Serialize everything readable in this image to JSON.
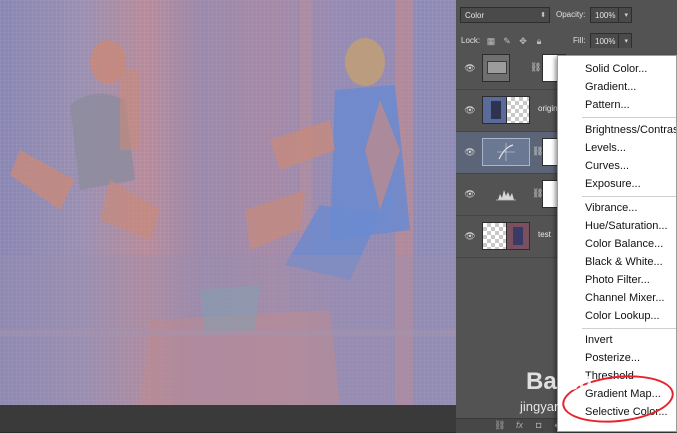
{
  "options_bar": {
    "blend_mode": "Color",
    "opacity_label": "Opacity:",
    "opacity_value": "100%",
    "lock_label": "Lock:",
    "fill_label": "Fill:",
    "fill_value": "100%"
  },
  "layers": [
    {
      "name": "",
      "kind": "adjustment-fill",
      "selected": false
    },
    {
      "name": "origin",
      "kind": "image-masked",
      "selected": false
    },
    {
      "name": "",
      "kind": "adjustment-curves",
      "selected": true
    },
    {
      "name": "",
      "kind": "adjustment-levels",
      "selected": false
    },
    {
      "name": "test",
      "kind": "image",
      "selected": false
    }
  ],
  "menu": {
    "group1": [
      "Solid Color...",
      "Gradient...",
      "Pattern..."
    ],
    "group2": [
      "Brightness/Contrast...",
      "Levels...",
      "Curves...",
      "Exposure..."
    ],
    "group3": [
      "Vibrance...",
      "Hue/Saturation...",
      "Color Balance...",
      "Black & White...",
      "Photo Filter...",
      "Channel Mixer...",
      "Color Lookup..."
    ],
    "group4": [
      "Invert",
      "Posterize...",
      "Threshold",
      "Gradient Map...",
      "Selective Color..."
    ]
  },
  "bottom_bar": {
    "link_icon": "link-icon",
    "fx_label": "fx"
  },
  "watermark": {
    "brand": "Baidu",
    "sub": "jingyan"
  },
  "colors": {
    "highlight_ellipse": "#e8222c",
    "selected_layer": "#5c6478"
  }
}
